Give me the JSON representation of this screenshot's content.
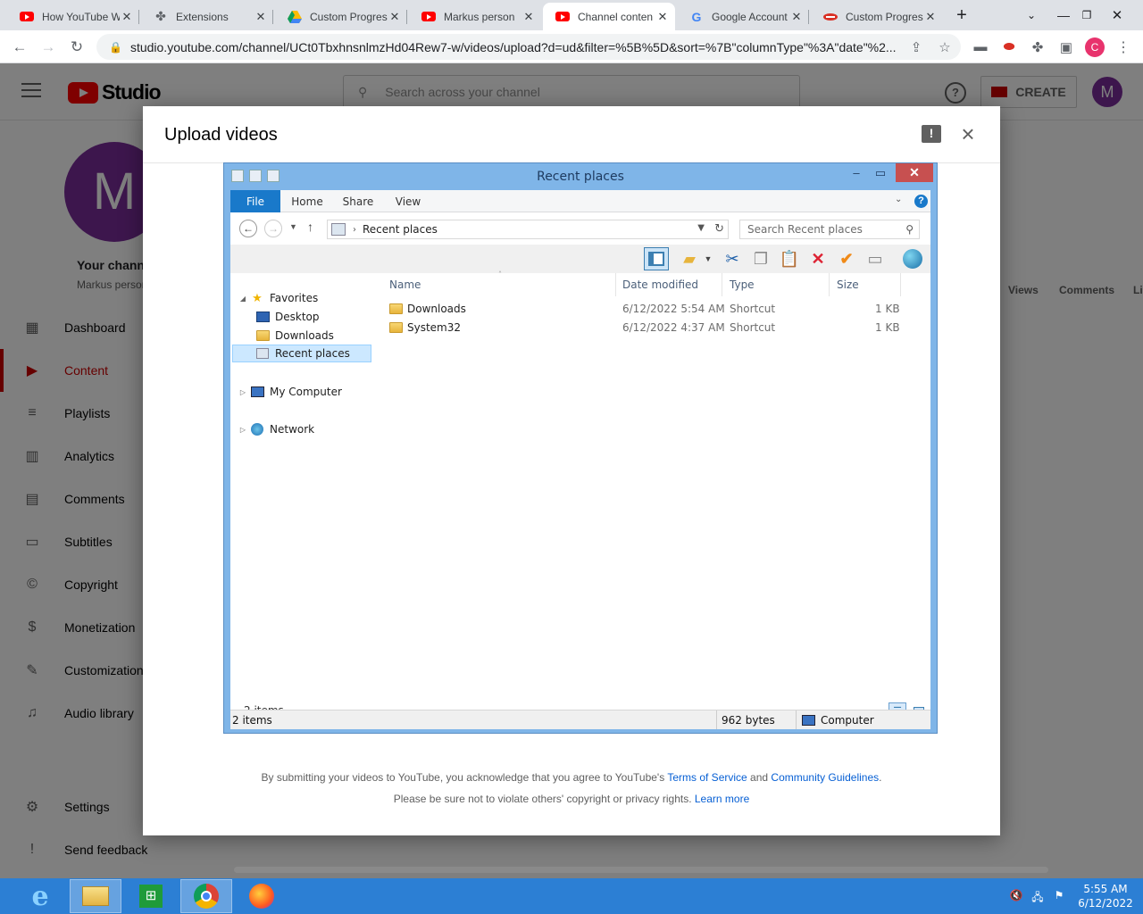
{
  "browser": {
    "tabs": [
      {
        "title": "How YouTube W",
        "icon": "youtube-icon",
        "active": false
      },
      {
        "title": "Extensions",
        "icon": "puzzle-icon",
        "active": false
      },
      {
        "title": "Custom Progres",
        "icon": "drive-icon",
        "active": false
      },
      {
        "title": "Markus person",
        "icon": "youtube-icon",
        "active": false
      },
      {
        "title": "Channel conten",
        "icon": "youtube-icon",
        "active": true
      },
      {
        "title": "Google Account",
        "icon": "google-icon",
        "active": false
      },
      {
        "title": "Custom Progres",
        "icon": "progressbar-icon",
        "active": false
      }
    ],
    "url": "studio.youtube.com/channel/UCt0TbxhnsnlmzHd04Rew7-w/videos/upload?d=ud&filter=%5B%5D&sort=%7B\"columnType\"%3A\"date\"%2...",
    "profile_initial": "C"
  },
  "studio": {
    "logo_text": "Studio",
    "search_placeholder": "Search across your channel",
    "create_label": "CREATE",
    "avatar_initial": "M",
    "big_avatar_initial": "M",
    "channel_title": "Your channel",
    "channel_subtitle": "Markus personal",
    "nav": [
      {
        "label": "Dashboard",
        "icon": "dashboard-icon"
      },
      {
        "label": "Content",
        "icon": "content-icon",
        "active": true
      },
      {
        "label": "Playlists",
        "icon": "playlists-icon"
      },
      {
        "label": "Analytics",
        "icon": "analytics-icon"
      },
      {
        "label": "Comments",
        "icon": "comments-icon"
      },
      {
        "label": "Subtitles",
        "icon": "subtitles-icon"
      },
      {
        "label": "Copyright",
        "icon": "copyright-icon"
      },
      {
        "label": "Monetization",
        "icon": "monetization-icon"
      },
      {
        "label": "Customization",
        "icon": "customization-icon"
      },
      {
        "label": "Audio library",
        "icon": "audio-library-icon"
      },
      {
        "label": "Settings",
        "icon": "settings-icon"
      },
      {
        "label": "Send feedback",
        "icon": "feedback-icon"
      }
    ],
    "table_columns": [
      "Views",
      "Comments",
      "Li"
    ]
  },
  "upload_dialog": {
    "title": "Upload videos",
    "footer_line1_prefix": "By submitting your videos to YouTube, you acknowledge that you agree to YouTube's ",
    "terms_link": "Terms of Service",
    "and_text": " and ",
    "guidelines_link": "Community Guidelines",
    "period": ".",
    "footer_line2_prefix": "Please be sure not to violate others' copyright or privacy rights. ",
    "learn_more": "Learn more"
  },
  "explorer": {
    "title": "Recent places",
    "ribbon_tabs": [
      "File",
      "Home",
      "Share",
      "View"
    ],
    "address_path": "Recent places",
    "search_placeholder": "Search Recent places",
    "tree": {
      "favorites": "Favorites",
      "desktop": "Desktop",
      "downloads": "Downloads",
      "recent": "Recent places",
      "computer": "My Computer",
      "network": "Network"
    },
    "columns": [
      "Name",
      "Date modified",
      "Type",
      "Size"
    ],
    "files": [
      {
        "name": "Downloads",
        "date": "6/12/2022 5:54 AM",
        "type": "Shortcut",
        "size": "1 KB"
      },
      {
        "name": "System32",
        "date": "6/12/2022 4:37 AM",
        "type": "Shortcut",
        "size": "1 KB"
      }
    ],
    "item_count": "2 items",
    "status": {
      "items": "2 items",
      "size": "962 bytes",
      "location": "Computer"
    }
  },
  "taskbar": {
    "time": "5:55 AM",
    "date": "6/12/2022",
    "apps": [
      "internet-explorer-icon",
      "file-explorer-icon",
      "store-icon",
      "chrome-icon",
      "firefox-icon"
    ]
  }
}
